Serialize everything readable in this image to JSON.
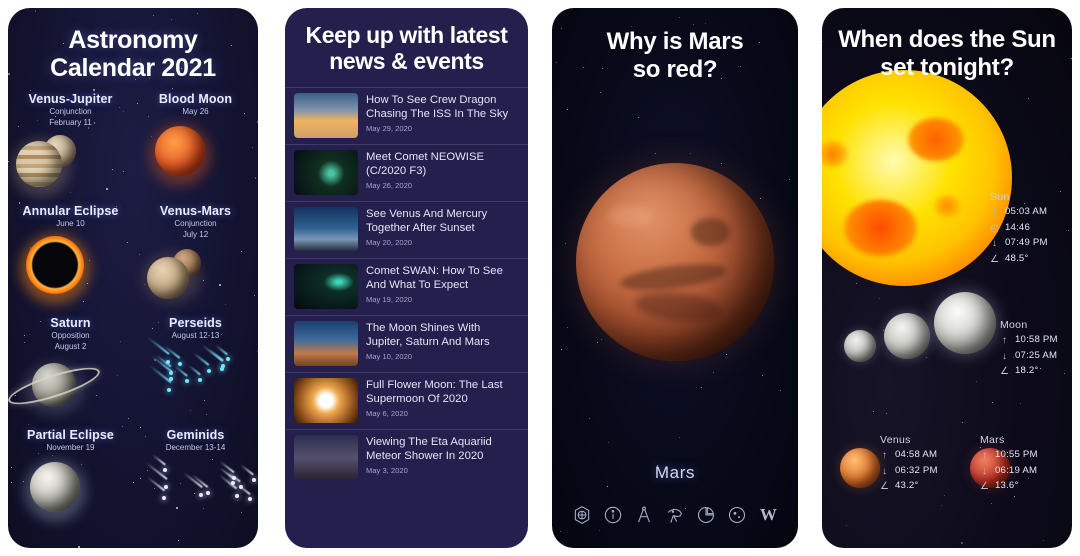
{
  "panels": {
    "calendar": {
      "title_line1": "Astronomy",
      "title_line2": "Calendar 2021",
      "events": [
        {
          "name": "Venus-Jupiter",
          "sub1": "Conjunction",
          "sub2": "February 11",
          "art": "venus-jupiter"
        },
        {
          "name": "Blood Moon",
          "sub1": "May 26",
          "sub2": "",
          "art": "blood-moon"
        },
        {
          "name": "Annular Eclipse",
          "sub1": "June 10",
          "sub2": "",
          "art": "annular-eclipse"
        },
        {
          "name": "Venus-Mars",
          "sub1": "Conjunction",
          "sub2": "July 12",
          "art": "venus-mars"
        },
        {
          "name": "Saturn",
          "sub1": "Opposition",
          "sub2": "August 2",
          "art": "saturn"
        },
        {
          "name": "Perseids",
          "sub1": "August 12-13",
          "sub2": "",
          "art": "perseids"
        },
        {
          "name": "Partial Eclipse",
          "sub1": "November 19",
          "sub2": "",
          "art": "partial-eclipse"
        },
        {
          "name": "Geminids",
          "sub1": "December 13-14",
          "sub2": "",
          "art": "geminids"
        }
      ]
    },
    "news": {
      "title_line1": "Keep up with latest",
      "title_line2": "news & events",
      "items": [
        {
          "headline": "How To See Crew Dragon Chasing The ISS In The Sky",
          "date": "May 29, 2020",
          "thumb": "rocket-launch-thumbnail"
        },
        {
          "headline": "Meet Comet NEOWISE (C/2020 F3)",
          "date": "May 26, 2020",
          "thumb": "comet-neowise-thumbnail"
        },
        {
          "headline": "See Venus And Mercury Together After Sunset",
          "date": "May 20, 2020",
          "thumb": "twilight-sky-thumbnail"
        },
        {
          "headline": "Comet SWAN: How To See And What To Expect",
          "date": "May 19, 2020",
          "thumb": "comet-swan-thumbnail"
        },
        {
          "headline": "The Moon Shines With Jupiter, Saturn And Mars",
          "date": "May 10, 2020",
          "thumb": "moon-planets-thumbnail"
        },
        {
          "headline": "Full Flower Moon: The Last Supermoon Of 2020",
          "date": "May 6, 2020",
          "thumb": "full-moon-thumbnail"
        },
        {
          "headline": "Viewing The Eta Aquariid Meteor Shower In 2020",
          "date": "May 3, 2020",
          "thumb": "meteor-shower-thumbnail"
        }
      ]
    },
    "mars": {
      "title_line1": "Why is Mars",
      "title_line2": "so red?",
      "object_label": "Mars",
      "toolbar": [
        {
          "icon": "planet-globe-icon"
        },
        {
          "icon": "info-icon"
        },
        {
          "icon": "compass-icon"
        },
        {
          "icon": "sky-view-icon"
        },
        {
          "icon": "pie-chart-icon"
        },
        {
          "icon": "moon-phase-icon"
        },
        {
          "icon": "wikipedia-icon",
          "label": "W"
        }
      ]
    },
    "sun": {
      "title_line1": "When does the Sun",
      "title_line2": "set tonight?",
      "bodies": [
        {
          "name": "Sun",
          "rows": [
            {
              "icon": "rise-arrow-icon",
              "glyph": "↑",
              "value": "05:03 AM"
            },
            {
              "icon": "duration-clock-icon",
              "glyph": "◴",
              "value": "14:46"
            },
            {
              "icon": "set-arrow-icon",
              "glyph": "↓",
              "value": "07:49 PM"
            },
            {
              "icon": "altitude-angle-icon",
              "glyph": "∠",
              "value": "48.5°"
            }
          ]
        },
        {
          "name": "Moon",
          "rows": [
            {
              "icon": "rise-arrow-icon",
              "glyph": "↑",
              "value": "10:58 PM"
            },
            {
              "icon": "set-arrow-icon",
              "glyph": "↓",
              "value": "07:25 AM"
            },
            {
              "icon": "altitude-angle-icon",
              "glyph": "∠",
              "value": "18.2°"
            }
          ]
        },
        {
          "name": "Venus",
          "rows": [
            {
              "icon": "rise-arrow-icon",
              "glyph": "↑",
              "value": "04:58 AM"
            },
            {
              "icon": "set-arrow-icon",
              "glyph": "↓",
              "value": "06:32 PM"
            },
            {
              "icon": "altitude-angle-icon",
              "glyph": "∠",
              "value": "43.2°"
            }
          ]
        },
        {
          "name": "Mars",
          "rows": [
            {
              "icon": "rise-arrow-icon",
              "glyph": "↑",
              "value": "10:55 PM"
            },
            {
              "icon": "set-arrow-icon",
              "glyph": "↓",
              "value": "06:19 AM"
            },
            {
              "icon": "altitude-angle-icon",
              "glyph": "∠",
              "value": "13.6°"
            }
          ]
        }
      ]
    }
  },
  "colors": {
    "calendar_bg": "#151535",
    "news_bg": "#241f4d",
    "mars_bg": "#080a1a",
    "sun_bg": "#0d0b1b",
    "mars_orange": "#c0603c",
    "sun_yellow": "#ffe000",
    "text_primary": "#ffffff",
    "text_secondary": "#c4c9e8"
  }
}
